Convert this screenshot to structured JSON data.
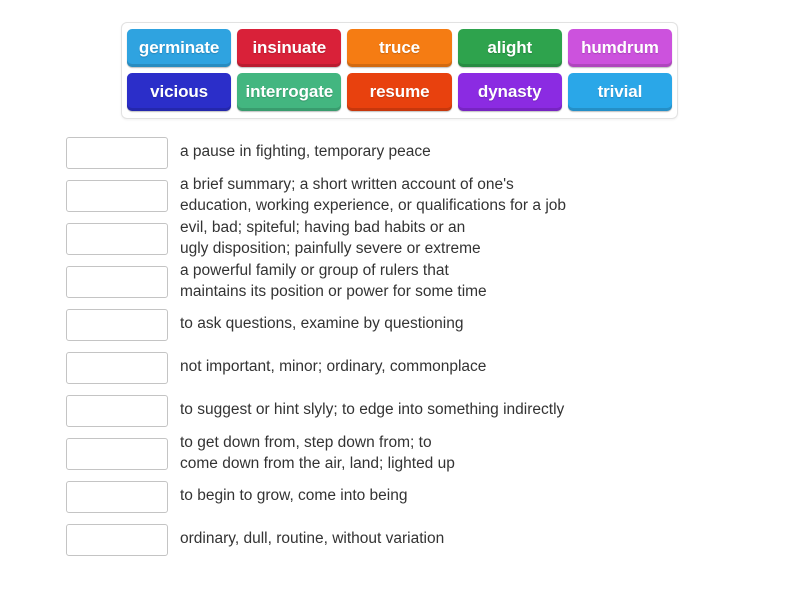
{
  "word_bank": {
    "rows": [
      [
        {
          "label": "germinate",
          "color": "#2fa3e0"
        },
        {
          "label": "insinuate",
          "color": "#d92139"
        },
        {
          "label": "truce",
          "color": "#f57c13"
        },
        {
          "label": "alight",
          "color": "#2ea34d"
        },
        {
          "label": "humdrum",
          "color": "#cc52dd"
        }
      ],
      [
        {
          "label": "vicious",
          "color": "#2b2ec9"
        },
        {
          "label": "interrogate",
          "color": "#43b680"
        },
        {
          "label": "resume",
          "color": "#e8410e"
        },
        {
          "label": "dynasty",
          "color": "#8b2be2"
        },
        {
          "label": "trivial",
          "color": "#2aa7e8"
        }
      ]
    ]
  },
  "definitions": [
    {
      "answer_value": "",
      "text": "a pause in fighting, temporary peace",
      "lines": 1
    },
    {
      "answer_value": "",
      "text": "a brief summary; a short written account of one's\neducation, working experience, or qualifications for a job",
      "lines": 2
    },
    {
      "answer_value": "",
      "text": "evil, bad; spiteful; having bad habits or an\nugly disposition; painfully severe or extreme",
      "lines": 2
    },
    {
      "answer_value": "",
      "text": "a powerful family or group of rulers that\nmaintains its position or power for some time",
      "lines": 2
    },
    {
      "answer_value": "",
      "text": "to ask questions, examine by questioning",
      "lines": 1
    },
    {
      "answer_value": "",
      "text": "not important, minor; ordinary, commonplace",
      "lines": 1
    },
    {
      "answer_value": "",
      "text": "to suggest or hint slyly; to edge into something indirectly",
      "lines": 1
    },
    {
      "answer_value": "",
      "text": "to get down from, step down from; to\ncome down from the air, land; lighted up",
      "lines": 2
    },
    {
      "answer_value": "",
      "text": "to begin to grow, come into being",
      "lines": 1
    },
    {
      "answer_value": "",
      "text": "ordinary, dull, routine, without variation",
      "lines": 1
    }
  ]
}
